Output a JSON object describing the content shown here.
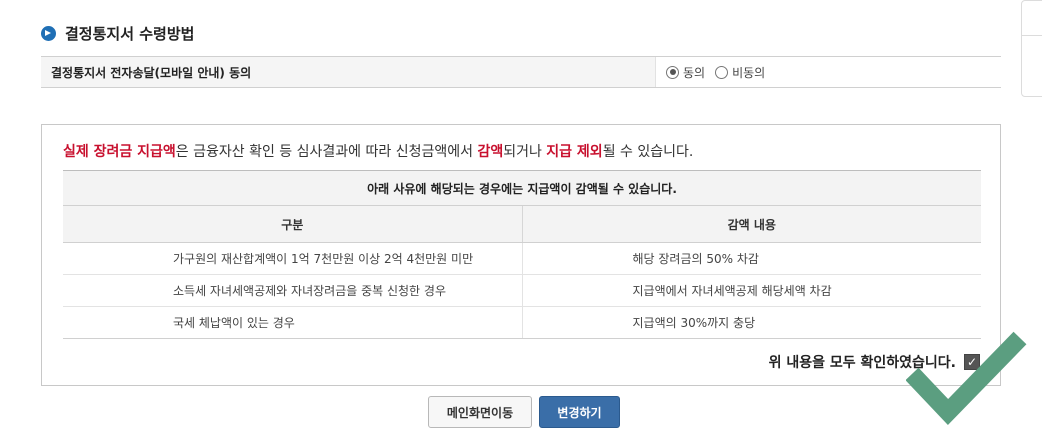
{
  "section": {
    "title": "결정통지서 수령방법",
    "icon": "circle-arrow-icon"
  },
  "consent": {
    "label": "결정통지서 전자송달(모바일 안내) 동의",
    "options": [
      {
        "label": "동의",
        "checked": true
      },
      {
        "label": "비동의",
        "checked": false
      }
    ]
  },
  "notice": {
    "lead_red1": "실제 장려금 지급액",
    "lead_text1": "은 금융자산 확인 등 심사결과에 따라 신청금액에서 ",
    "lead_red2": "감액",
    "lead_text2": "되거나 ",
    "lead_red3": "지급 제외",
    "lead_text3": "될 수 있습니다.",
    "table_caption": "아래 사유에 해당되는 경우에는 지급액이 감액될 수 있습니다.",
    "columns": [
      "구분",
      "감액 내용"
    ],
    "rows": [
      {
        "category": "가구원의 재산합계액이 1억 7천만원 이상 2억 4천만원 미만",
        "detail": "해당 장려금의 50% 차감"
      },
      {
        "category": "소득세 자녀세액공제와 자녀장려금을 중복 신청한 경우",
        "detail": "지급액에서 자녀세액공제 해당세액 차감"
      },
      {
        "category": "국세 체납액이 있는 경우",
        "detail": "지급액의 30%까지 충당"
      }
    ],
    "confirm_label": "위 내용을 모두 확인하였습니다.",
    "confirm_checked": true
  },
  "buttons": {
    "main": "메인화면이동",
    "change": "변경하기"
  },
  "colors": {
    "accent_blue": "#3a6ea8",
    "warning_red": "#c8102e",
    "check_green": "#5b9e80"
  }
}
